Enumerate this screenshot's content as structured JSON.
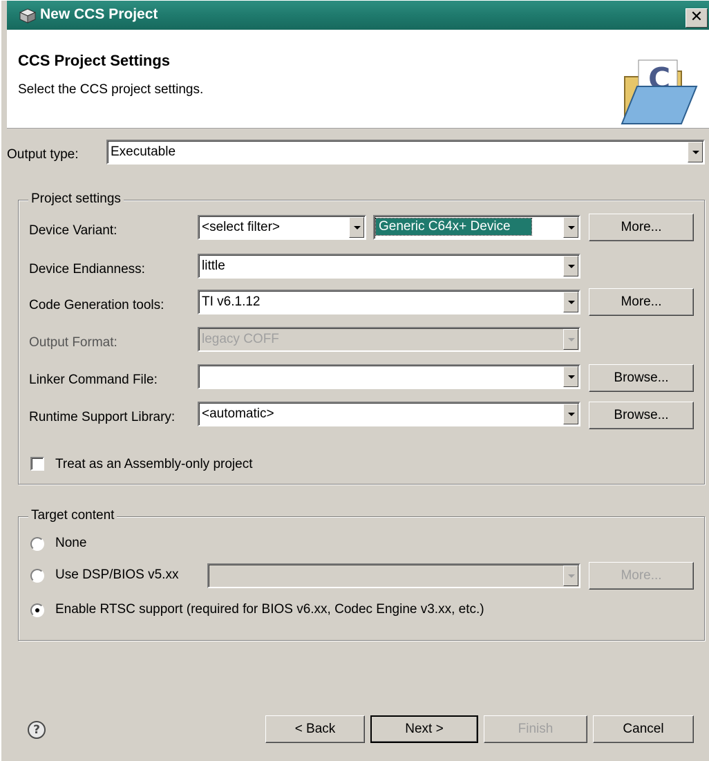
{
  "window": {
    "title": "New CCS Project",
    "close_glyph": "✕"
  },
  "banner": {
    "title": "CCS Project Settings",
    "description": "Select the CCS project settings.",
    "icon": "folder-c-icon"
  },
  "output_type": {
    "label": "Output type:",
    "value": "Executable"
  },
  "project_settings": {
    "group_title": "Project settings",
    "device_variant": {
      "label": "Device Variant:",
      "filter_value": "<select filter>",
      "device_value": "Generic C64x+ Device",
      "more_button": "More..."
    },
    "device_endianness": {
      "label": "Device Endianness:",
      "value": "little"
    },
    "code_generation_tools": {
      "label": "Code Generation tools:",
      "value": "TI v6.1.12",
      "more_button": "More..."
    },
    "output_format": {
      "label": "Output Format:",
      "value": "legacy COFF"
    },
    "linker_command_file": {
      "label": "Linker Command File:",
      "value": "",
      "browse_button": "Browse..."
    },
    "runtime_support_library": {
      "label": "Runtime Support Library:",
      "value": "<automatic>",
      "browse_button": "Browse..."
    },
    "assembly_only": {
      "label": "Treat as an Assembly-only project",
      "checked": false
    }
  },
  "target_content": {
    "group_title": "Target content",
    "none_label": "None",
    "dsp_bios_label": "Use DSP/BIOS v5.xx",
    "dsp_bios_value": "",
    "dsp_bios_more": "More...",
    "rtsc_label": "Enable RTSC support (required for BIOS v6.xx, Codec Engine v3.xx, etc.)",
    "selected": "rtsc"
  },
  "footer": {
    "help_glyph": "?",
    "back_button": "< Back",
    "next_button": "Next >",
    "finish_button": "Finish",
    "cancel_button": "Cancel"
  }
}
